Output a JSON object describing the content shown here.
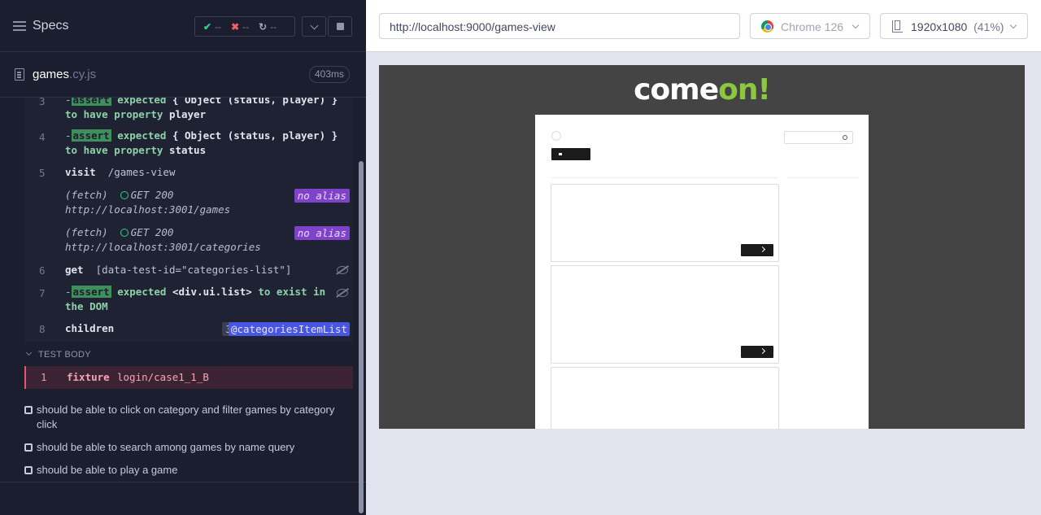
{
  "sidebar": {
    "title": "Specs",
    "stats": {
      "passed": "--",
      "failed": "--",
      "pending": "--"
    }
  },
  "file": {
    "name": "games",
    "ext": ".cy.js",
    "duration": "403ms"
  },
  "commands": [
    {
      "num": "3",
      "assert": "assert",
      "text_a": "expected",
      "text_b": "{ Object (status, player) }",
      "line2_a": "to have property",
      "line2_b": "player"
    },
    {
      "num": "4",
      "assert": "assert",
      "text_a": "expected",
      "text_b": "{ Object (status, player) }",
      "line2_a": "to have property",
      "line2_b": "status"
    },
    {
      "num": "5",
      "cmd": "visit",
      "arg": "/games-view"
    },
    {
      "fetch": "(fetch)",
      "method": "GET 200",
      "url": "http://localhost:3001/games",
      "alias": "no alias"
    },
    {
      "fetch": "(fetch)",
      "method": "GET 200",
      "url": "http://localhost:3001/categories",
      "alias": "no alias"
    },
    {
      "num": "6",
      "cmd": "get",
      "arg": "[data-test-id=\"categories-list\"]"
    },
    {
      "num": "7",
      "assert": "assert",
      "text_a": "expected",
      "text_b": "<div.ui.list>",
      "text_c": "to exist in",
      "line2_a": "the DOM"
    },
    {
      "num": "8",
      "cmd": "children",
      "count": "3",
      "alias": "@categoriesItemList"
    }
  ],
  "test_body": {
    "label": "TEST BODY",
    "fixture": {
      "num": "1",
      "cmd": "fixture",
      "arg": "login/case1_1_B"
    }
  },
  "tests": [
    {
      "title": "should be able to click on category and filter games by category click"
    },
    {
      "title": "should be able to search among games by name query"
    },
    {
      "title": "should be able to play a game"
    }
  ],
  "toolbar": {
    "url": "http://localhost:9000/games-view",
    "browser": "Chrome 126",
    "viewport": "1920x1080",
    "zoom": "(41%)"
  },
  "app": {
    "logo_a": "come",
    "logo_b": "on!"
  }
}
